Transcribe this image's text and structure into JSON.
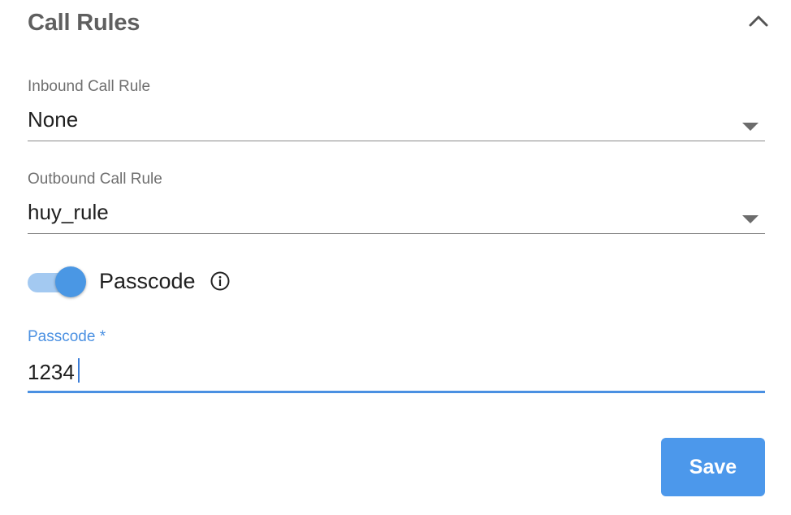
{
  "header": {
    "title": "Call Rules",
    "collapse_icon": "chevron-up-icon"
  },
  "inbound": {
    "label": "Inbound Call Rule",
    "value": "None"
  },
  "outbound": {
    "label": "Outbound Call Rule",
    "value": "huy_rule"
  },
  "passcode_toggle": {
    "label": "Passcode",
    "enabled": true,
    "info_icon": "info-icon"
  },
  "passcode_field": {
    "label": "Passcode *",
    "value": "1234"
  },
  "actions": {
    "save_label": "Save"
  },
  "colors": {
    "accent": "#4a90e2",
    "button": "#4c98eb",
    "toggle_track": "#a3c9f1"
  }
}
